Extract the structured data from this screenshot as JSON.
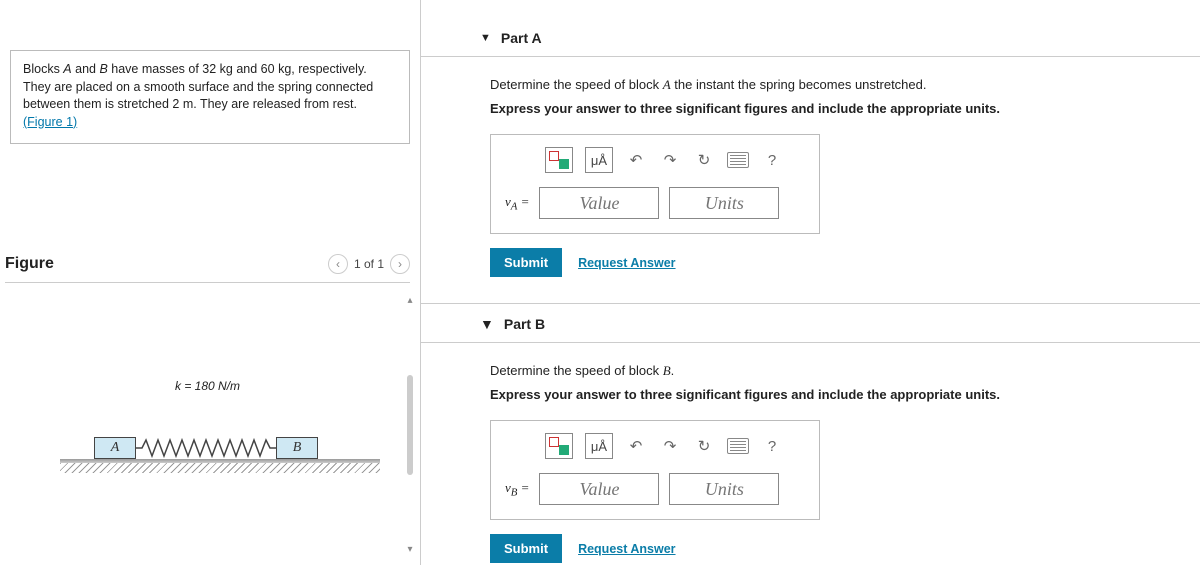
{
  "problem": {
    "text_pre": "Blocks ",
    "A": "A",
    "mid1": " and ",
    "B": "B",
    "mid2": " have masses of 32 ",
    "kg1": "kg",
    "mid3": " and 60 ",
    "kg2": "kg",
    "mid4": ", respectively. They are placed on a smooth surface and the spring connected between them is stretched 2 ",
    "m": "m",
    "mid5": ". They are released from rest.",
    "figure_link": "(Figure 1)"
  },
  "figure": {
    "heading": "Figure",
    "pager": "1 of 1",
    "k_label": "k = 180 N/m",
    "block_a": "A",
    "block_b": "B"
  },
  "partA": {
    "title": "Part A",
    "prompt_pre": "Determine the speed of block ",
    "prompt_var": "A",
    "prompt_post": " the instant the spring becomes unstretched.",
    "instruction": "Express your answer to three significant figures and include the appropriate units.",
    "mu_label": "μÅ",
    "help_q": "?",
    "var_label": "v_A =",
    "value_placeholder": "Value",
    "units_placeholder": "Units",
    "submit": "Submit",
    "request": "Request Answer"
  },
  "partB": {
    "title": "Part B",
    "prompt_pre": "Determine the speed of block ",
    "prompt_var": "B",
    "prompt_post": ".",
    "instruction": "Express your answer to three significant figures and include the appropriate units.",
    "mu_label": "μÅ",
    "help_q": "?",
    "var_label": "v_B =",
    "value_placeholder": "Value",
    "units_placeholder": "Units",
    "submit": "Submit",
    "request": "Request Answer"
  }
}
